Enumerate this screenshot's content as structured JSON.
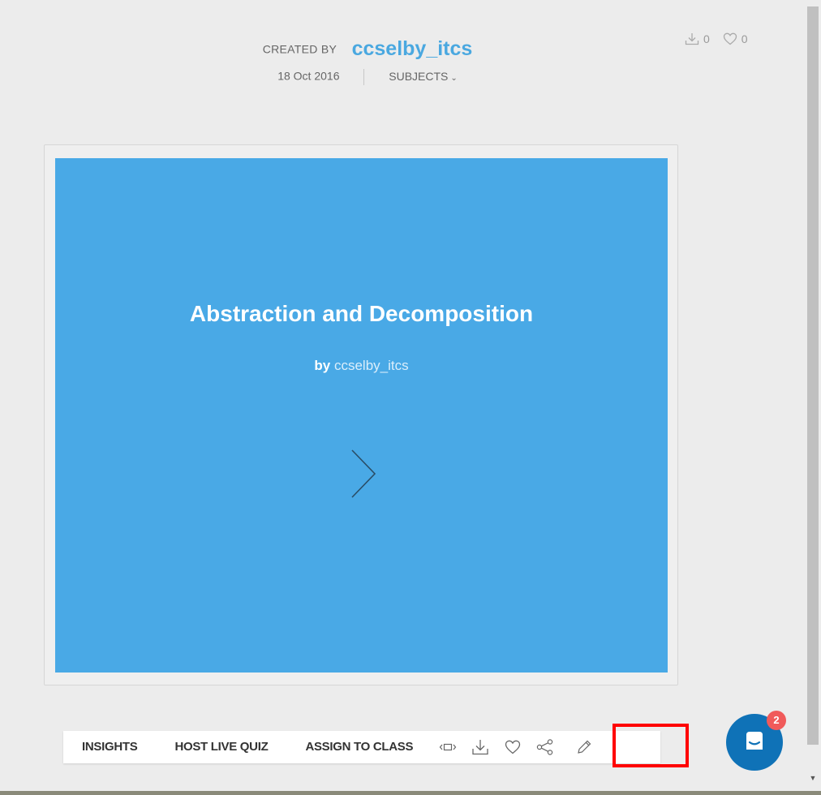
{
  "header": {
    "created_by_label": "CREATED BY",
    "author": "ccselby_itcs",
    "date": "18 Oct 2016",
    "subjects_label": "SUBJECTS"
  },
  "stats": {
    "downloads": "0",
    "likes": "0"
  },
  "slide": {
    "title": "Abstraction and Decomposition",
    "by_label": "by",
    "author": "ccselby_itcs",
    "background_color": "#49a9e6"
  },
  "toolbar": {
    "buttons": [
      {
        "label": "INSIGHTS"
      },
      {
        "label": "HOST LIVE QUIZ"
      },
      {
        "label": "ASSIGN TO CLASS"
      }
    ],
    "icons": [
      "embed-icon",
      "download-icon",
      "heart-icon",
      "share-icon",
      "edit-pencil-icon"
    ]
  },
  "chat": {
    "badge_count": "2",
    "color": "#0f72b7"
  },
  "colors": {
    "accent": "#4aa8e0",
    "highlight_box": "#ff0000",
    "badge": "#f05a5a"
  }
}
